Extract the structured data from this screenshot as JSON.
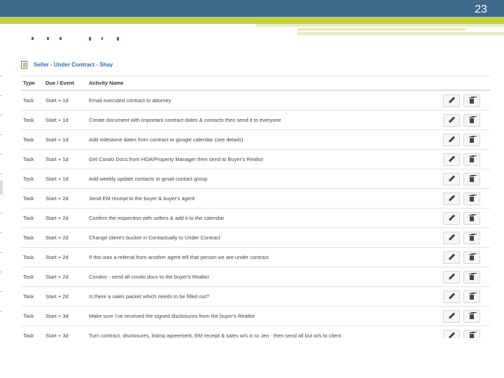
{
  "slide": {
    "number": "23"
  },
  "plan": {
    "title": "Seller - Under Contract - Shay"
  },
  "table": {
    "headers": {
      "type": "Type",
      "due": "Due / Event",
      "name": "Activity Name"
    },
    "rows": [
      {
        "type": "Task",
        "due": "Start + 1d",
        "name": "Email executed contract to attorney"
      },
      {
        "type": "Task",
        "due": "Start + 1d",
        "name": "Create document with important contract dates & contacts then send it to everyone"
      },
      {
        "type": "Task",
        "due": "Start + 1d",
        "name": "Add milestone dates from contract to google calendar (see details)"
      },
      {
        "type": "Task",
        "due": "Start + 1d",
        "name": "Get Condo Docs from HOA/Property Manager then send to Buyer's Realtor"
      },
      {
        "type": "Task",
        "due": "Start + 1d",
        "name": "Add weekly update contacts to gmail contact group"
      },
      {
        "type": "Task",
        "due": "Start + 2d",
        "name": "Send EM receipt to the buyer & buyer's agent"
      },
      {
        "type": "Task",
        "due": "Start + 2d",
        "name": "Confirm the inspection with sellers & add it to the calendar"
      },
      {
        "type": "Task",
        "due": "Start + 2d",
        "name": "Change client's bucket in Contactually to Under Contract"
      },
      {
        "type": "Task",
        "due": "Start + 2d",
        "name": "If this was a referral from another agent tell that person we are under contract"
      },
      {
        "type": "Task",
        "due": "Start + 2d",
        "name": "Condos - send all condo docs to the buyer's Realtor"
      },
      {
        "type": "Task",
        "due": "Start + 2d",
        "name": "Is there a sales packet which needs to be filled out?"
      },
      {
        "type": "Task",
        "due": "Start + 3d",
        "name": "Make sure I've received the signed disclosures from the buyer's Realtor"
      },
      {
        "type": "Task",
        "due": "Start + 3d",
        "name": "Turn contract, disclosures, listing agreement, EM receipt & sales w/s in to Jen - then send all but w/s to client"
      }
    ]
  },
  "icons": {
    "edit": "pencil-icon",
    "delete": "trash-icon",
    "plan": "document-icon"
  },
  "colors": {
    "topbar": "#3f6a8c",
    "accent": "#c5cf3a",
    "link": "#2c6eb5"
  }
}
